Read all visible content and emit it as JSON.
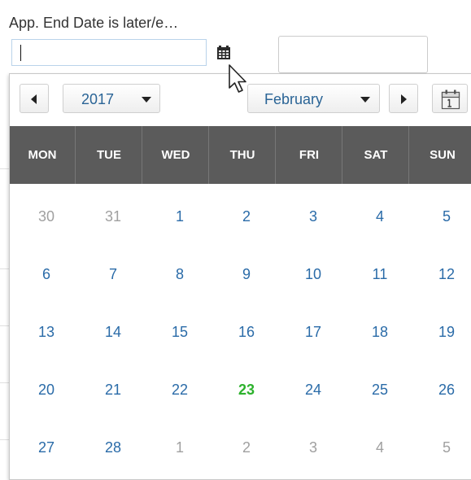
{
  "field": {
    "label": "App. End Date is later/e…",
    "value": ""
  },
  "icons": {
    "calendar": "calendar-icon",
    "cursor": "mouse-pointer-icon",
    "prev": "arrow-left-icon",
    "next": "arrow-right-icon",
    "today": "calendar-today-icon"
  },
  "datepicker": {
    "year": "2017",
    "month": "February",
    "weekdays": [
      "MON",
      "TUE",
      "WED",
      "THU",
      "FRI",
      "SAT",
      "SUN"
    ],
    "weeks": [
      [
        {
          "d": "30",
          "other": true
        },
        {
          "d": "31",
          "other": true
        },
        {
          "d": "1"
        },
        {
          "d": "2"
        },
        {
          "d": "3"
        },
        {
          "d": "4"
        },
        {
          "d": "5"
        }
      ],
      [
        {
          "d": "6"
        },
        {
          "d": "7"
        },
        {
          "d": "8"
        },
        {
          "d": "9"
        },
        {
          "d": "10"
        },
        {
          "d": "11"
        },
        {
          "d": "12"
        }
      ],
      [
        {
          "d": "13"
        },
        {
          "d": "14"
        },
        {
          "d": "15"
        },
        {
          "d": "16"
        },
        {
          "d": "17"
        },
        {
          "d": "18"
        },
        {
          "d": "19"
        }
      ],
      [
        {
          "d": "20"
        },
        {
          "d": "21"
        },
        {
          "d": "22"
        },
        {
          "d": "23",
          "today": true
        },
        {
          "d": "24"
        },
        {
          "d": "25"
        },
        {
          "d": "26"
        }
      ],
      [
        {
          "d": "27"
        },
        {
          "d": "28"
        },
        {
          "d": "1",
          "other": true
        },
        {
          "d": "2",
          "other": true
        },
        {
          "d": "3",
          "other": true
        },
        {
          "d": "4",
          "other": true
        },
        {
          "d": "5",
          "other": true
        }
      ]
    ]
  },
  "colors": {
    "header_bg": "#5b5b5b",
    "day_text": "#2a6ba8",
    "other_month_text": "#a0a0a0",
    "today_text": "#2db22d"
  }
}
